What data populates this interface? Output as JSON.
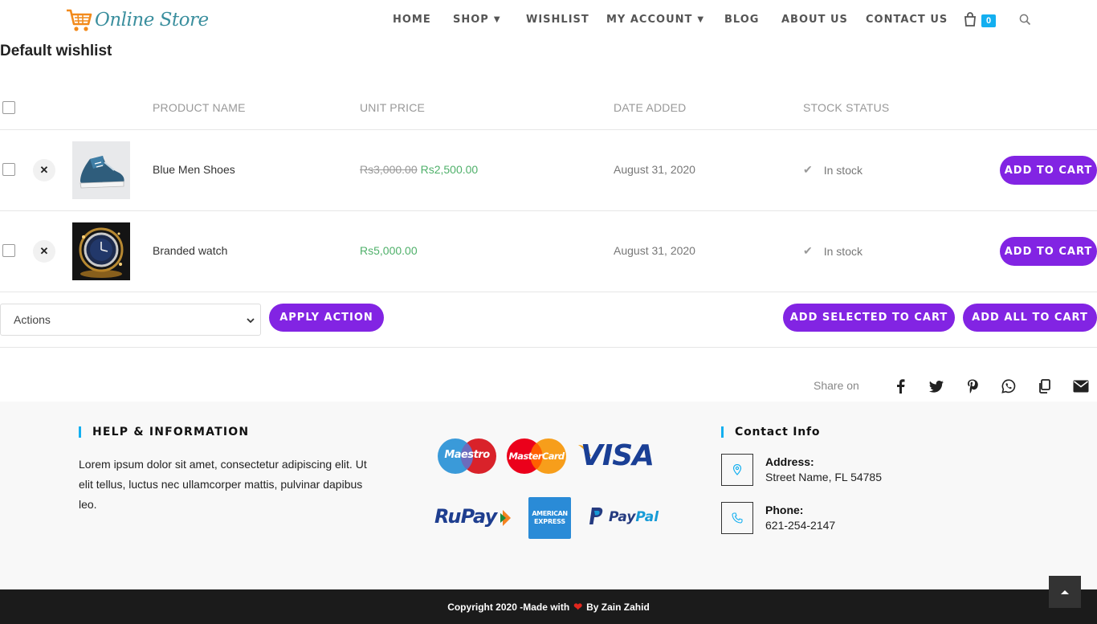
{
  "header": {
    "logo_text": "Online Store",
    "nav": {
      "home": "HOME",
      "shop": "SHOP",
      "wishlist": "WISHLIST",
      "my_account": "MY ACCOUNT",
      "blog": "BLOG",
      "about": "ABOUT US",
      "contact": "CONTACT US"
    },
    "cart_count": "0"
  },
  "page": {
    "title": "Default wishlist"
  },
  "table": {
    "columns": {
      "name": "PRODUCT NAME",
      "price": "UNIT PRICE",
      "date": "DATE ADDED",
      "stock": "STOCK STATUS"
    },
    "rows": [
      {
        "name": "Blue Men Shoes",
        "old_price": "Rs3,000.00",
        "price": "Rs2,500.00",
        "date": "August 31, 2020",
        "stock": "In stock",
        "button": "ADD TO CART",
        "image": "sneaker-image"
      },
      {
        "name": "Branded watch",
        "old_price": "",
        "price": "Rs5,000.00",
        "date": "August 31, 2020",
        "stock": "In stock",
        "button": "ADD TO CART",
        "image": "watch-image"
      }
    ]
  },
  "actions": {
    "select_value": "Actions",
    "apply": "APPLY ACTION",
    "add_selected": "ADD SELECTED TO CART",
    "add_all": "ADD ALL TO CART"
  },
  "share": {
    "label": "Share on",
    "icons": [
      "facebook-icon",
      "twitter-icon",
      "pinterest-icon",
      "whatsapp-icon",
      "copy-icon",
      "email-icon"
    ]
  },
  "footer": {
    "help_title": "HELP & INFORMATION",
    "help_text": "Lorem ipsum dolor sit amet, consectetur adipiscing elit. Ut elit tellus, luctus nec ullamcorper mattis, pulvinar dapibus leo.",
    "payments": {
      "maestro": "Maestro",
      "mastercard": "MasterCard",
      "visa": "VISA",
      "rupay": "RuPay",
      "amex_line1": "AMERICAN",
      "amex_line2": "EXPRESS",
      "paypal_pay": "Pay",
      "paypal_pal": "Pal"
    },
    "contact_title": "Contact Info",
    "address_label": "Address:",
    "address_value": "Street Name, FL 54785",
    "phone_label": "Phone:",
    "phone_value": "621-254-2147"
  },
  "copyright": {
    "before": "Copyright 2020 -Made with",
    "after": "By Zain Zahid"
  },
  "colors": {
    "accent": "#8224e3",
    "sale_price": "#4fb06a",
    "brand_blue": "#13aff0",
    "footer_bar": "#1b1b1b"
  }
}
